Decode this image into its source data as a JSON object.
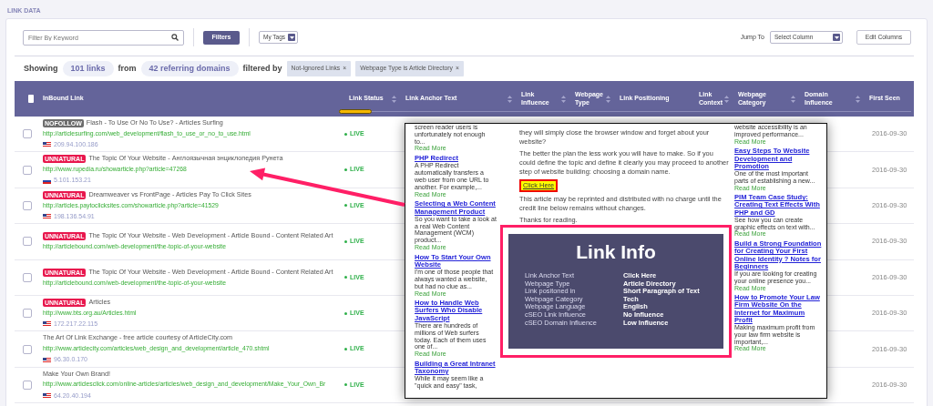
{
  "section_title": "LINK DATA",
  "toolbar": {
    "search": {
      "placeholder": "Filter By Keyword"
    },
    "filters_button": "Filters",
    "tags_select": "My Tags",
    "jump_label": "Jump To",
    "jump_select": "Select Column",
    "edit_button": "Edit Columns"
  },
  "summary": {
    "showing": "Showing",
    "links_count": "101 links",
    "from": "from",
    "domains_count": "42 referring domains",
    "filtered_by": "filtered by",
    "filters": [
      {
        "label": "Not-Ignored Links",
        "remove": "×"
      },
      {
        "label": "Webpage Type is Article Directory",
        "remove": "×"
      }
    ]
  },
  "table": {
    "select_all": {
      "checked": false
    },
    "columns": [
      {
        "label": "InBound Link",
        "sortable": false
      },
      {
        "label": "Link Status",
        "sortable": true
      },
      {
        "label": "Link Anchor Text",
        "sortable": true
      },
      {
        "label": "Link Influence",
        "sortable": true
      },
      {
        "label": "Webpage Type",
        "sortable": true
      },
      {
        "label": "Link Positioning",
        "sortable": false
      },
      {
        "label": "Link Context",
        "sortable": true
      },
      {
        "label": "Webpage Category",
        "sortable": true
      },
      {
        "label": "Domain Influence",
        "sortable": true
      },
      {
        "label": "First Seen",
        "sortable": false
      }
    ],
    "rows": [
      {
        "checked": false,
        "badge": {
          "kind": "nofollow",
          "label": "NOFOLLOW"
        },
        "title": "Flash - To Use Or No To Use? - Articles Surfing",
        "url": "http://articlesurfing.com/web_development/flash_to_use_or_no_to_use.html",
        "flag": {
          "kind": "us"
        },
        "ip": "209.94.100.186",
        "status": "LIVE",
        "first_seen": "2016-09-30"
      },
      {
        "checked": false,
        "badge": {
          "kind": "unnatural",
          "label": "UNNATURAL"
        },
        "title": "The Topic Of Your Website - Англоязычная энциклопедия Рунета",
        "url": "http://www.rupedia.ru/showarticle.php?article=47268",
        "flag": {
          "kind": "ru"
        },
        "ip": "5.101.153.21",
        "status": "LIVE",
        "first_seen": "2016-09-30"
      },
      {
        "checked": false,
        "badge": {
          "kind": "unnatural",
          "label": "UNNATURAL"
        },
        "title": "Dreamweaver vs FrontPage - Articles Pay To Click Sites",
        "url": "http://articles.paytoclicksites.com/showarticle.php?article=41529",
        "flag": {
          "kind": "us"
        },
        "ip": "198.136.54.91",
        "status": "LIVE",
        "first_seen": "2016-09-30"
      },
      {
        "checked": false,
        "badge": {
          "kind": "unnatural",
          "label": "UNNATURAL"
        },
        "title": "The Topic Of Your Website - Web Development - Article Bound - Content Related Art",
        "url": "http://articlebound.com/web-development/the-topic-of-your-website",
        "status": "LIVE",
        "first_seen": "2016-09-30"
      },
      {
        "checked": false,
        "badge": {
          "kind": "unnatural",
          "label": "UNNATURAL"
        },
        "title": "The Topic Of Your Website - Web Development - Article Bound - Content Related Art",
        "url": "http://articlebound.com/web-development/the-topic-of-your-website",
        "status": "LIVE",
        "first_seen": "2016-09-30"
      },
      {
        "checked": false,
        "badge": {
          "kind": "unnatural",
          "label": "UNNATURAL"
        },
        "title": "Articles",
        "url": "http://www.bts.org.au/Articles.html",
        "flag": {
          "kind": "us"
        },
        "ip": "172.217.22.115",
        "status": "LIVE",
        "first_seen": "2016-09-30"
      },
      {
        "checked": false,
        "title": "The Art Of Link Exchange - free article courtesy of ArticleCity.com",
        "url": "http://www.articlecity.com/articles/web_design_and_development/article_470.shtml",
        "flag": {
          "kind": "us"
        },
        "ip": "96.30.0.170",
        "status": "LIVE",
        "first_seen": "2016-09-30"
      },
      {
        "checked": false,
        "title": "Make Your Own Brand!",
        "url": "http://www.articlesclick.com/online-articles/articles/web_design_and_development/Make_Your_Own_Br",
        "flag": {
          "kind": "us"
        },
        "ip": "64.20.40.194",
        "status": "LIVE",
        "first_seen": "2016-09-30"
      }
    ]
  },
  "article_snapshot": {
    "left_column": [
      {
        "kind": "text",
        "text": "screen reader users is unfortunately not enough to...",
        "more": "Read More"
      },
      {
        "kind": "link",
        "text": "PHP Redirect"
      },
      {
        "kind": "text",
        "text": "A PHP Redirect automatically transfers a web user from one URL to another. For example,...",
        "more": "Read More"
      },
      {
        "kind": "link",
        "text": "Selecting a Web Content Management Product"
      },
      {
        "kind": "text",
        "text": "So you want to take a look at a real Web Content Management (WCM) product...",
        "more": "Read More"
      },
      {
        "kind": "link",
        "text": "How To Start Your Own Website"
      },
      {
        "kind": "text",
        "text": "I'm one of those people that always wanted a website, but had no clue as...",
        "more": "Read More"
      },
      {
        "kind": "link",
        "text": "How to Handle Web Surfers Who Disable JavaScript"
      },
      {
        "kind": "text",
        "text": "There are hundreds of millions of Web surfers today. Each of them uses one of...",
        "more": "Read More"
      },
      {
        "kind": "link",
        "text": "Building a Great Intranet Taxonomy"
      },
      {
        "kind": "text",
        "text": "While it may seem like a \"quick and easy\" task,"
      }
    ],
    "main_column": [
      {
        "kind": "text",
        "text": "they will simply close the browser window and forget about your website?"
      },
      {
        "kind": "text",
        "text": "The better the plan the less work you will have to make. So if you could define the topic and define it clearly you may proceed to another step of website building: choosing a domain name."
      },
      {
        "kind": "highlight",
        "text": "Click Here"
      },
      {
        "kind": "text",
        "text": "This article may be reprinted and distributed with no charge until the credit line below remains without changes."
      },
      {
        "kind": "text",
        "text": "Thanks for reading."
      }
    ],
    "right_column": [
      {
        "kind": "text",
        "text": "website accessibility is an improved performance...",
        "more": "Read More"
      },
      {
        "kind": "link",
        "text": "Easy Steps To Website Development and Promotion"
      },
      {
        "kind": "text",
        "text": "One of the most important parts of establishing a new...",
        "more": "Read More"
      },
      {
        "kind": "link",
        "text": "PIM Team Case Study: Creating Text Effects With PHP and GD"
      },
      {
        "kind": "text",
        "text": "See how you can create graphic effects on text with...",
        "more": "Read More"
      },
      {
        "kind": "link",
        "text": "Build a Strong Foundation for Creating Your First Online Identity ? Notes for Beginners"
      },
      {
        "kind": "text",
        "text": "If you are looking for creating your online presence you...",
        "more": "Read More"
      },
      {
        "kind": "link",
        "text": "How to Promote Your Law Firm Website On the Internet for Maximum Profit"
      },
      {
        "kind": "text",
        "text": "Making maximum profit from your law firm website is important,...",
        "more": "Read More"
      }
    ]
  },
  "link_info": {
    "title": "Link Info",
    "rows": [
      {
        "label": "Link Anchor Text",
        "value": "Click Here"
      },
      {
        "label": "Webpage Type",
        "value": "Article Directory"
      },
      {
        "label": "Link positoned in",
        "value": "Short Paragraph of Text"
      },
      {
        "label": "Webpage Category",
        "value": "Tech"
      },
      {
        "label": "Webpage Language",
        "value": "English"
      },
      {
        "label": "cSEO Link Influence",
        "value": "No Influence"
      },
      {
        "label": "cSEO Domain Influence",
        "value": "Low Influence"
      }
    ]
  }
}
